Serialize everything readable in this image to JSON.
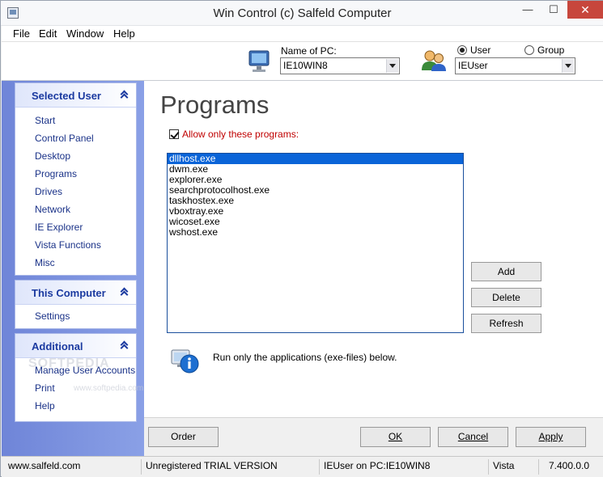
{
  "window": {
    "title": "Win Control (c) Salfeld Computer",
    "minimize": "—",
    "maximize": "☐",
    "close": "✕"
  },
  "menu": [
    "File",
    "Edit",
    "Window",
    "Help"
  ],
  "toolbar": {
    "pc_label": "Name of PC:",
    "pc_value": "IE10WIN8",
    "radio_user": "User",
    "radio_group": "Group",
    "user_value": "IEUser"
  },
  "sidebar": {
    "selected_user": {
      "title": "Selected User",
      "items": [
        "Start",
        "Control Panel",
        "Desktop",
        "Programs",
        "Drives",
        "Network",
        "IE Explorer",
        "Vista Functions",
        "Misc"
      ]
    },
    "this_computer": {
      "title": "This Computer",
      "items": [
        "Settings"
      ]
    },
    "additional": {
      "title": "Additional",
      "items": [
        "Manage User Accounts",
        "Print",
        "Help"
      ]
    }
  },
  "main": {
    "title": "Programs",
    "allow_label": "Allow only these programs:",
    "programs": [
      "dllhost.exe",
      "dwm.exe",
      "explorer.exe",
      "searchprotocolhost.exe",
      "taskhostex.exe",
      "vboxtray.exe",
      "wicoset.exe",
      "wshost.exe"
    ],
    "add": "Add",
    "delete": "Delete",
    "refresh": "Refresh",
    "info": "Run only the applications (exe-files) below."
  },
  "buttons": {
    "order": "Order",
    "ok": "OK",
    "cancel": "Cancel",
    "apply": "Apply"
  },
  "status": {
    "site": "www.salfeld.com",
    "license": "Unregistered TRIAL VERSION",
    "context": "IEUser on PC:IE10WIN8",
    "os": "Vista",
    "version": "7.400.0.0"
  },
  "watermark": {
    "main": "SOFTPEDIA",
    "url": "www.softpedia.com"
  }
}
